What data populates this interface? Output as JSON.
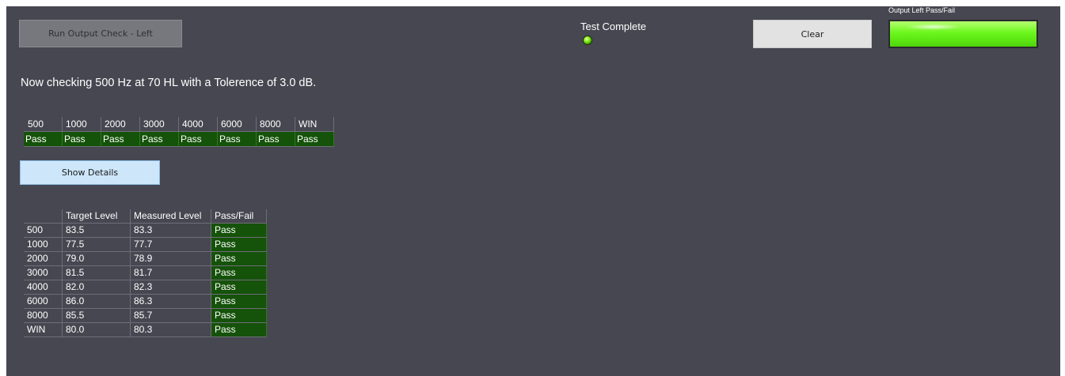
{
  "buttons": {
    "run": "Run Output Check - Left",
    "clear": "Clear",
    "show_details": "Show Details"
  },
  "test_status": {
    "label": "Test Complete",
    "led_on": true,
    "led_color": "#7fe21a"
  },
  "pass_fail_indicator": {
    "label": "Output Left Pass/Fail",
    "state": "pass",
    "color": "#5fea14"
  },
  "status_message": "Now checking 500  Hz at 70 HL with a Tolerence of 3.0 dB.",
  "summary": {
    "headers": [
      "500",
      "1000",
      "2000",
      "3000",
      "4000",
      "6000",
      "8000",
      "WIN"
    ],
    "results": [
      "Pass",
      "Pass",
      "Pass",
      "Pass",
      "Pass",
      "Pass",
      "Pass",
      "Pass"
    ]
  },
  "details": {
    "columns": [
      "",
      "Target Level",
      "Measured Level",
      "Pass/Fail"
    ],
    "rows": [
      {
        "freq": "500",
        "target": "83.5",
        "measured": "83.3",
        "result": "Pass"
      },
      {
        "freq": "1000",
        "target": "77.5",
        "measured": "77.7",
        "result": "Pass"
      },
      {
        "freq": "2000",
        "target": "79.0",
        "measured": "78.9",
        "result": "Pass"
      },
      {
        "freq": "3000",
        "target": "81.5",
        "measured": "81.7",
        "result": "Pass"
      },
      {
        "freq": "4000",
        "target": "82.0",
        "measured": "82.3",
        "result": "Pass"
      },
      {
        "freq": "6000",
        "target": "86.0",
        "measured": "86.3",
        "result": "Pass"
      },
      {
        "freq": "8000",
        "target": "85.5",
        "measured": "85.7",
        "result": "Pass"
      },
      {
        "freq": "WIN",
        "target": "80.0",
        "measured": "80.3",
        "result": "Pass"
      }
    ]
  },
  "colors": {
    "panel_bg": "#474751",
    "pass_cell": "#15520a",
    "show_details_bg": "#cde6fa"
  }
}
